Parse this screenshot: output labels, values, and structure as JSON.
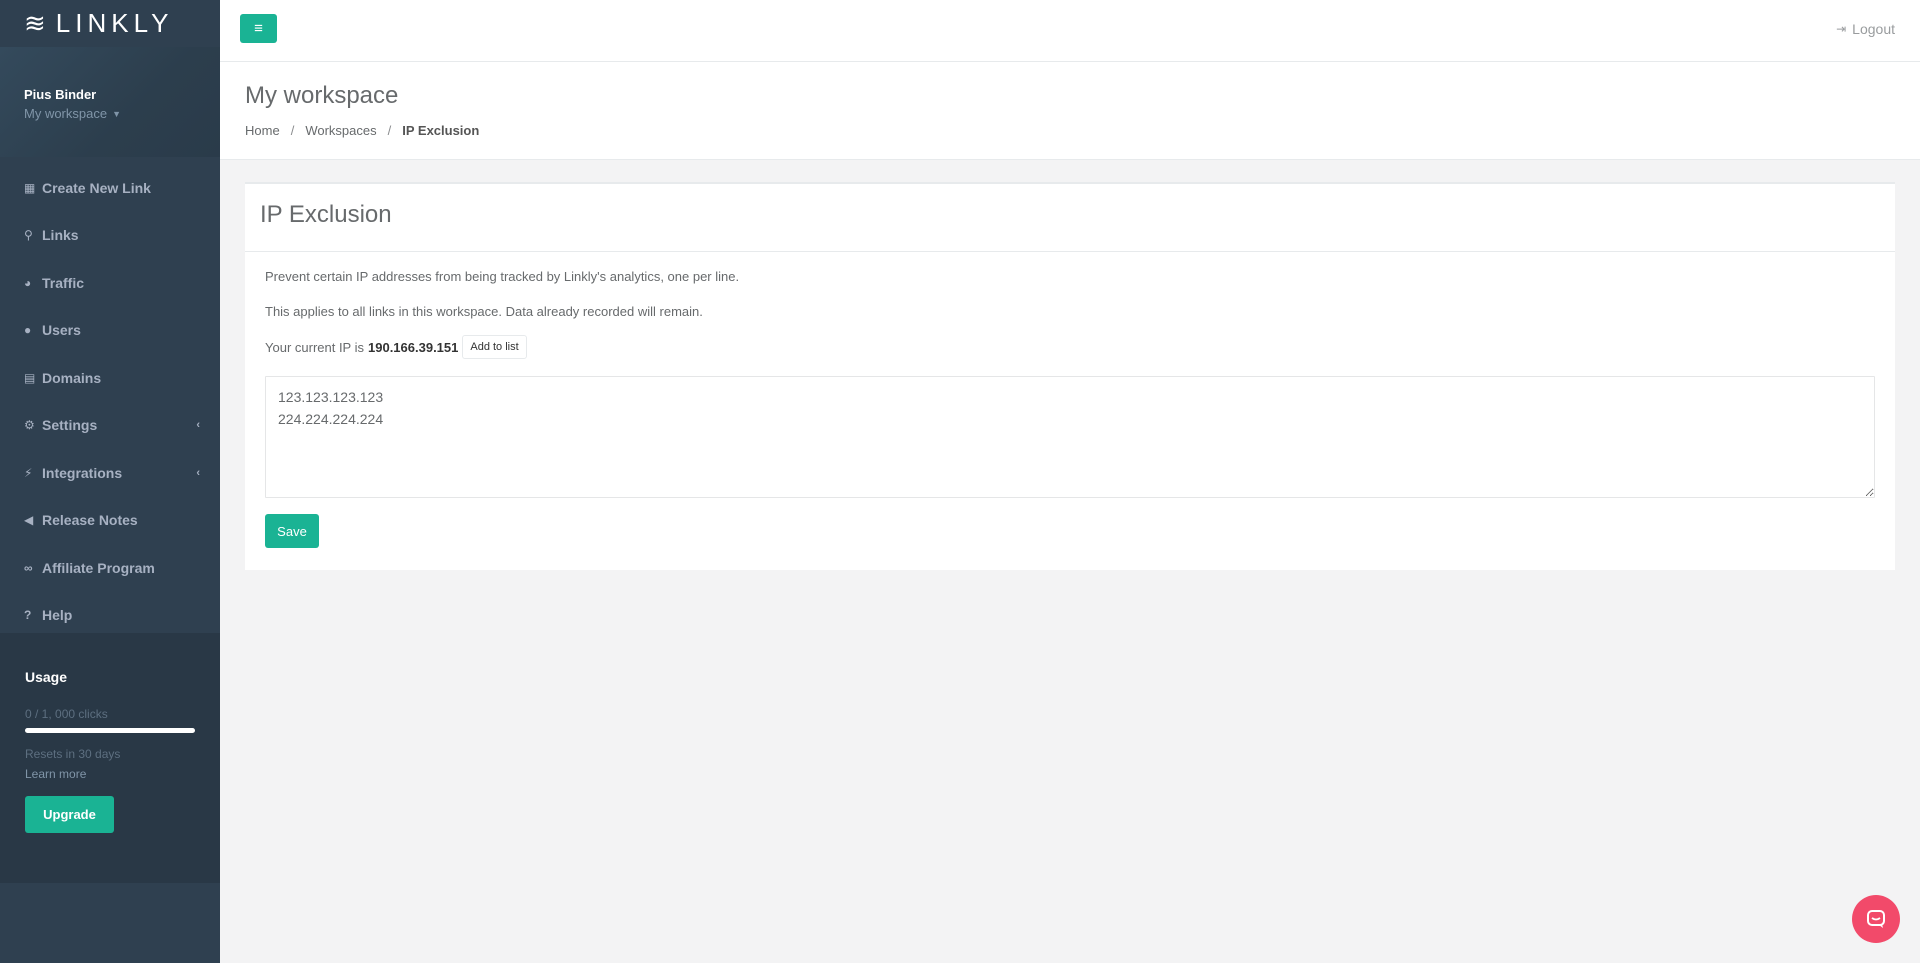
{
  "brand": {
    "logo_text": "LINKLY",
    "logo_mark": "≋"
  },
  "profile": {
    "name": "Pius Binder",
    "workspace": "My workspace"
  },
  "nav": [
    {
      "label": "Create New Link",
      "icon": "grid-icon",
      "glyph": "▦"
    },
    {
      "label": "Links",
      "icon": "link-icon",
      "glyph": "⚲"
    },
    {
      "label": "Traffic",
      "icon": "pie-chart-icon",
      "glyph": "◕"
    },
    {
      "label": "Users",
      "icon": "user-icon",
      "glyph": "●"
    },
    {
      "label": "Domains",
      "icon": "server-icon",
      "glyph": "▤"
    },
    {
      "label": "Settings",
      "icon": "cogs-icon",
      "glyph": "⚙",
      "has_submenu": true
    },
    {
      "label": "Integrations",
      "icon": "plug-icon",
      "glyph": "⚡",
      "has_submenu": true
    },
    {
      "label": "Release Notes",
      "icon": "bullhorn-icon",
      "glyph": "◀"
    },
    {
      "label": "Affiliate Program",
      "icon": "handshake-icon",
      "glyph": "∞"
    },
    {
      "label": "Help",
      "icon": "question-icon",
      "glyph": "?"
    }
  ],
  "usage": {
    "title": "Usage",
    "clicks_text": "0 / 1, 000 clicks",
    "progress": 0,
    "reset_text": "Resets in 30 days",
    "learn_more": "Learn more",
    "upgrade_label": "Upgrade"
  },
  "topbar": {
    "logout_label": "Logout"
  },
  "heading": {
    "title": "My workspace",
    "breadcrumb": [
      "Home",
      "Workspaces",
      "IP Exclusion"
    ]
  },
  "ip_exclusion": {
    "title": "IP Exclusion",
    "description_1": "Prevent certain IP addresses from being tracked by Linkly's analytics, one per line.",
    "description_2": "This applies to all links in this workspace. Data already recorded will remain.",
    "current_ip_prefix": "Your current IP is",
    "current_ip": "190.166.39.151",
    "add_to_list_label": "Add to list",
    "textarea_value": "123.123.123.123\n224.224.224.224",
    "save_label": "Save"
  },
  "colors": {
    "sidebar_bg": "#2f4050",
    "accent": "#1ab394",
    "chat_launcher": "#f24a6a"
  }
}
